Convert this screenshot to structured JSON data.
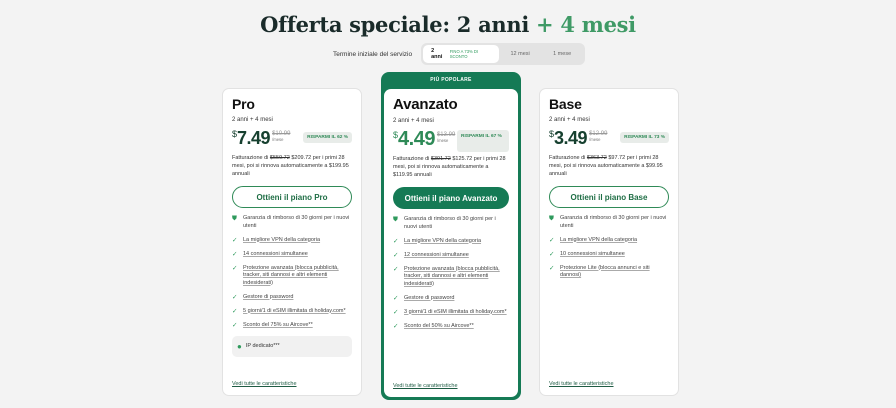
{
  "headline": {
    "main": "Offerta speciale: 2 anni",
    "accent": "+ 4 mesi"
  },
  "term": {
    "label": "Termine iniziale del servizio",
    "options": [
      {
        "label": "2 anni",
        "note": "FINO A 73% DI SCONTO",
        "active": true
      },
      {
        "label": "12 mesi"
      },
      {
        "label": "1 mese"
      }
    ]
  },
  "plans": {
    "pro": {
      "name": "Pro",
      "subtitle": "2 anni + 4 mesi",
      "currency": "$",
      "price": "7.49",
      "old_price": "$10.99",
      "per": "/mese",
      "badge": "RISPARMI IL 62 %",
      "billing_prefix": "Fatturazione di",
      "billing_old": "$559.72",
      "billing_rest": "$209.72 per i primi 28 mesi, poi si rinnova automaticamente a $199.95 annuali",
      "cta": "Ottieni il piano Pro",
      "features": [
        "Garanzia di rimborso di 30 giorni per i nuovi utenti",
        "La migliore VPN della categoria",
        "14 connessioni simultanee",
        "Protezione avanzata (blocca pubblicità, tracker, siti dannosi e altri elementi indesiderati)",
        "Gestore di password",
        "5 giorni/1 di eSIM illimitata di holiday.com*",
        "Sconto del 75% su Aircove**"
      ],
      "extra": "IP dedicato***",
      "see_all": "Vedi tutte le caratteristiche"
    },
    "advanced": {
      "popular": "PIÙ POPOLARE",
      "name": "Avanzato",
      "subtitle": "2 anni + 4 mesi",
      "currency": "$",
      "price": "4.49",
      "old_price": "$13.99",
      "per": "/mese",
      "badge": "RISPARMI IL 67 %",
      "billing_prefix": "Fatturazione di",
      "billing_old": "$391.72",
      "billing_rest": "$125.72 per i primi 28 mesi, poi si rinnova automaticamente a $119.95 annuali",
      "cta": "Ottieni il piano Avanzato",
      "features": [
        "Garanzia di rimborso di 30 giorni per i nuovi utenti",
        "La migliore VPN della categoria",
        "12 connessioni simultanee",
        "Protezione avanzata (blocca pubblicità, tracker, siti dannosi e altri elementi indesiderati)",
        "Gestore di password",
        "3 giorni/1 di eSIM illimitata di holiday.com*",
        "Sconto del 50% su Aircove**"
      ],
      "see_all": "Vedi tutte le caratteristiche"
    },
    "base": {
      "name": "Base",
      "subtitle": "2 anni + 4 mesi",
      "currency": "$",
      "price": "3.49",
      "old_price": "$12.99",
      "per": "/mese",
      "badge": "RISPARMI IL 73 %",
      "billing_prefix": "Fatturazione di",
      "billing_old": "$363.72",
      "billing_rest": "$97.72 per i primi 28 mesi, poi si rinnova automaticamente a $99.95 annuali",
      "cta": "Ottieni il piano Base",
      "features": [
        "Garanzia di rimborso di 30 giorni per i nuovi utenti",
        "La migliore VPN della categoria",
        "10 connessioni simultanee",
        "Protezione Lite (blocca annunci e siti dannosi)"
      ],
      "see_all": "Vedi tutte le caratteristiche"
    }
  },
  "colors": {
    "brand_green": "#157a55",
    "accent_green": "#3f9a66"
  }
}
